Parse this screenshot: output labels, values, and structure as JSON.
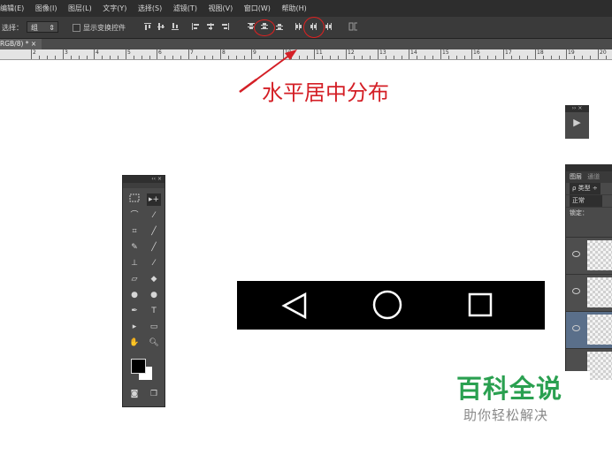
{
  "menubar": {
    "items": [
      "编辑(E)",
      "图像(I)",
      "图层(L)",
      "文字(Y)",
      "选择(S)",
      "滤镜(T)",
      "视图(V)",
      "窗口(W)",
      "帮助(H)"
    ]
  },
  "options": {
    "select_label": "选择：",
    "select_value": "组",
    "select_arrow": "⇕",
    "show_transform_label": "显示变换控件"
  },
  "document_tab": {
    "label": "RGB/8) *",
    "close": "×"
  },
  "ruler": {
    "ticks": [
      "2",
      "3",
      "4",
      "5",
      "6",
      "7",
      "8",
      "9",
      "10",
      "11",
      "12",
      "13",
      "14",
      "15",
      "16",
      "17",
      "18",
      "19",
      "20"
    ]
  },
  "annotation": {
    "text": "水平居中分布",
    "color": "#d41f26"
  },
  "toolbox": {
    "header": "‹‹ ×"
  },
  "mini_panel": {
    "header": "›› ×",
    "play": "▶"
  },
  "layers_panel": {
    "tab_layers": "图层",
    "tab_channels": "通道",
    "filter_label": "ρ 类型 ÷",
    "blend_mode": "正常",
    "lock_label": "锁定："
  },
  "watermark": {
    "title": "百科全说",
    "subtitle": "助你轻松解决",
    "title_color": "#2aa050"
  }
}
